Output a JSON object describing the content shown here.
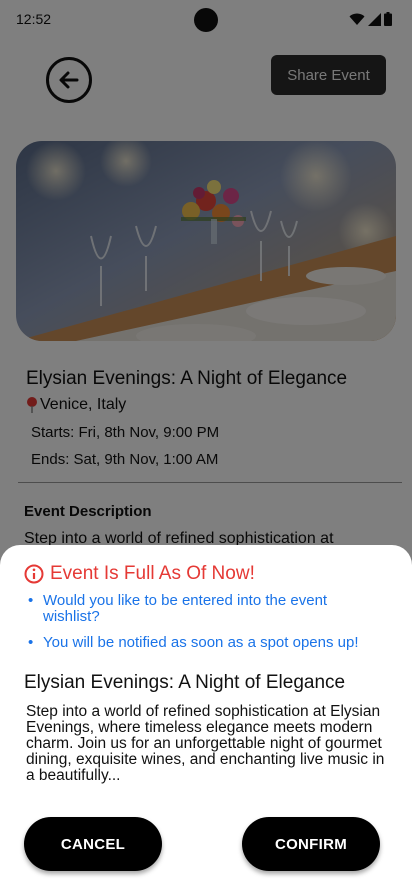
{
  "status_bar": {
    "time": "12:52"
  },
  "header": {
    "share_label": "Share Event"
  },
  "event": {
    "title": "Elysian Evenings: A Night of Elegance",
    "location": "Venice, Italy",
    "starts": "Starts: Fri, 8th Nov, 9:00 PM",
    "ends": "Ends: Sat, 9th Nov, 1:00 AM",
    "description_heading": "Event Description",
    "description_peek": "Step into a world of refined sophistication at"
  },
  "sheet": {
    "full_notice": "Event Is Full As Of Now!",
    "bullets": [
      "Would you like to be entered into the event wishlist?",
      "You will be notified as soon as a spot opens up!"
    ],
    "title": "Elysian Evenings: A Night of Elegance",
    "description": "Step into a world of refined sophistication at Elysian Evenings, where timeless elegance meets modern charm. Join us for an unforgettable night of gourmet dining, exquisite wines, and enchanting live music in a beautifully...",
    "cancel_label": "CANCEL",
    "confirm_label": "CONFIRM"
  },
  "icons": {
    "back": "arrow-left-circle-icon",
    "location": "map-pin-icon",
    "warning": "info-circle-icon",
    "wifi": "wifi-icon",
    "signal": "signal-icon",
    "battery": "battery-icon"
  },
  "colors": {
    "warning": "#e53935",
    "link": "#1a73e8",
    "button": "#000000"
  }
}
